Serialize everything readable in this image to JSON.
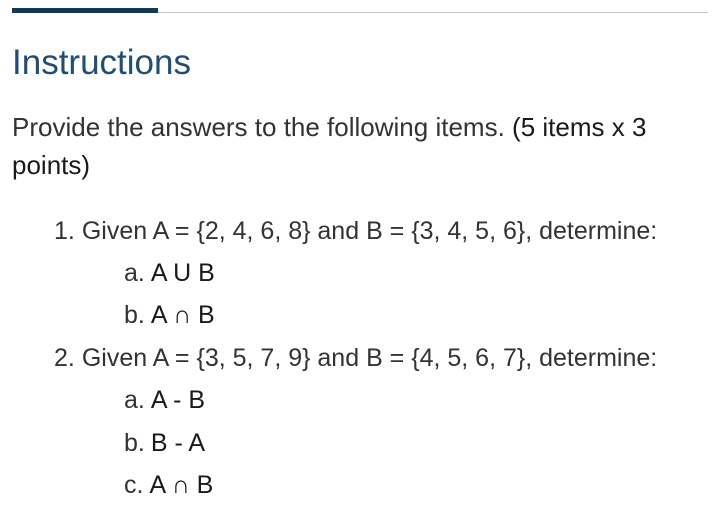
{
  "header": {
    "title": "Instructions"
  },
  "intro": {
    "text": "Provide the answers to the following items.",
    "points_note": "(5 items x 3 points)"
  },
  "colors": {
    "accent_bar": "#0e3a5c",
    "title": "#1f4e79",
    "rule": "#c8c8c8",
    "text": "#333333"
  },
  "items": [
    {
      "number": "1.",
      "prompt": "Given A = {2, 4, 6, 8} and B = {3, 4, 5, 6}, determine:",
      "subitems": [
        {
          "letter": "a.",
          "expression": "A U B"
        },
        {
          "letter": "b.",
          "expression": "A ∩ B"
        }
      ]
    },
    {
      "number": "2.",
      "prompt": "Given A = {3, 5, 7, 9} and B = {4, 5, 6, 7}, determine:",
      "subitems": [
        {
          "letter": "a.",
          "expression": "A - B"
        },
        {
          "letter": "b.",
          "expression": "B - A"
        },
        {
          "letter": "c.",
          "expression": "A ∩ B"
        }
      ]
    }
  ]
}
